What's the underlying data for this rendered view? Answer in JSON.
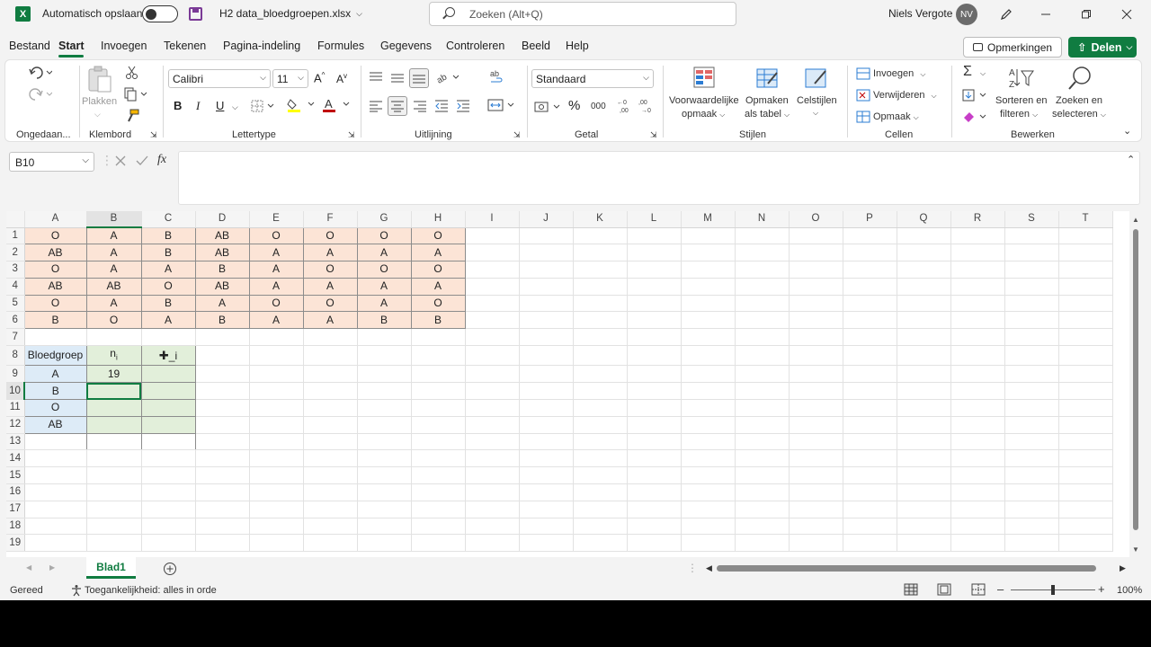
{
  "titlebar": {
    "app_icon_letter": "X",
    "autosave_label": "Automatisch opslaan",
    "filename": "H2 data_bloedgroepen.xlsx",
    "search_placeholder": "Zoeken (Alt+Q)",
    "user_name": "Niels Vergote",
    "user_initials": "NV"
  },
  "menu": {
    "tabs": [
      "Bestand",
      "Start",
      "Invoegen",
      "Tekenen",
      "Pagina-indeling",
      "Formules",
      "Gegevens",
      "Controleren",
      "Beeld",
      "Help"
    ],
    "active": "Start",
    "comments_label": "Opmerkingen",
    "share_label": "Delen"
  },
  "ribbon": {
    "groups": {
      "undo": "Ongedaan...",
      "clipboard": "Klembord",
      "font": "Lettertype",
      "alignment": "Uitlijning",
      "number": "Getal",
      "styles": "Stijlen",
      "cells": "Cellen",
      "editing": "Bewerken"
    },
    "paste_label": "Plakken",
    "font_name": "Calibri",
    "font_size": "11",
    "number_format": "Standaard",
    "bold": "B",
    "italic": "I",
    "underline": "U",
    "cond_format_1": "Voorwaardelijke",
    "cond_format_2": "opmaak",
    "format_table_1": "Opmaken",
    "format_table_2": "als tabel",
    "cell_styles": "Celstijlen",
    "insert": "Invoegen",
    "delete": "Verwijderen",
    "format": "Opmaak",
    "sort_1": "Sorteren en",
    "sort_2": "filteren",
    "find_1": "Zoeken en",
    "find_2": "selecteren"
  },
  "formula_bar": {
    "name_box": "B10",
    "formula": ""
  },
  "sheet": {
    "columns": [
      "A",
      "B",
      "C",
      "D",
      "E",
      "F",
      "G",
      "H",
      "I",
      "J",
      "K",
      "L",
      "M",
      "N",
      "O",
      "P",
      "Q",
      "R",
      "S",
      "T"
    ],
    "rows": [
      "1",
      "2",
      "3",
      "4",
      "5",
      "6",
      "7",
      "8",
      "9",
      "10",
      "11",
      "12",
      "13",
      "14",
      "15",
      "16",
      "17",
      "18",
      "19"
    ],
    "data_rows": [
      [
        "O",
        "A",
        "B",
        "AB",
        "O",
        "O",
        "O",
        "O"
      ],
      [
        "AB",
        "A",
        "B",
        "AB",
        "A",
        "A",
        "A",
        "A"
      ],
      [
        "O",
        "A",
        "A",
        "B",
        "A",
        "O",
        "O",
        "O"
      ],
      [
        "AB",
        "AB",
        "O",
        "AB",
        "A",
        "A",
        "A",
        "A"
      ],
      [
        "O",
        "A",
        "B",
        "A",
        "O",
        "O",
        "A",
        "O"
      ],
      [
        "B",
        "O",
        "A",
        "B",
        "A",
        "A",
        "B",
        "B"
      ]
    ],
    "freq_header": [
      "Bloedgroep",
      "n",
      "i",
      "_i"
    ],
    "freq_labels": [
      "A",
      "B",
      "O",
      "AB"
    ],
    "freq_n": [
      "19",
      "",
      "",
      ""
    ],
    "freq_f": [
      "",
      "",
      "",
      ""
    ]
  },
  "sheet_tabs": {
    "active": "Blad1"
  },
  "status": {
    "ready": "Gereed",
    "accessibility": "Toegankelijkheid: alles in orde",
    "zoom": "100%"
  },
  "colors": {
    "accent": "#107c41",
    "orange": "#fce4d6",
    "blue": "#ddebf7",
    "green": "#e2efda"
  }
}
